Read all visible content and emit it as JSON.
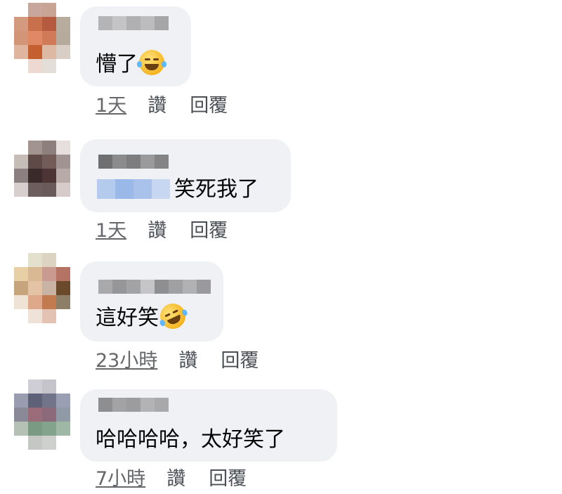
{
  "comments": [
    {
      "text": "懵了",
      "emoji": "face-with-tears-of-joy",
      "time": "1天",
      "like": "讚",
      "reply": "回覆"
    },
    {
      "text": "笑死我了",
      "time": "1天",
      "like": "讚",
      "reply": "回覆"
    },
    {
      "text": "這好笑",
      "emoji": "rolling-on-floor-laughing",
      "time": "23小時",
      "like": "讚",
      "reply": "回覆"
    },
    {
      "text": "哈哈哈哈，太好笑了",
      "time": "7小時",
      "like": "讚",
      "reply": "回覆"
    }
  ],
  "colors": {
    "bubble": "#eff1f4",
    "action_text": "#65676b",
    "comment_text": "#050505"
  }
}
